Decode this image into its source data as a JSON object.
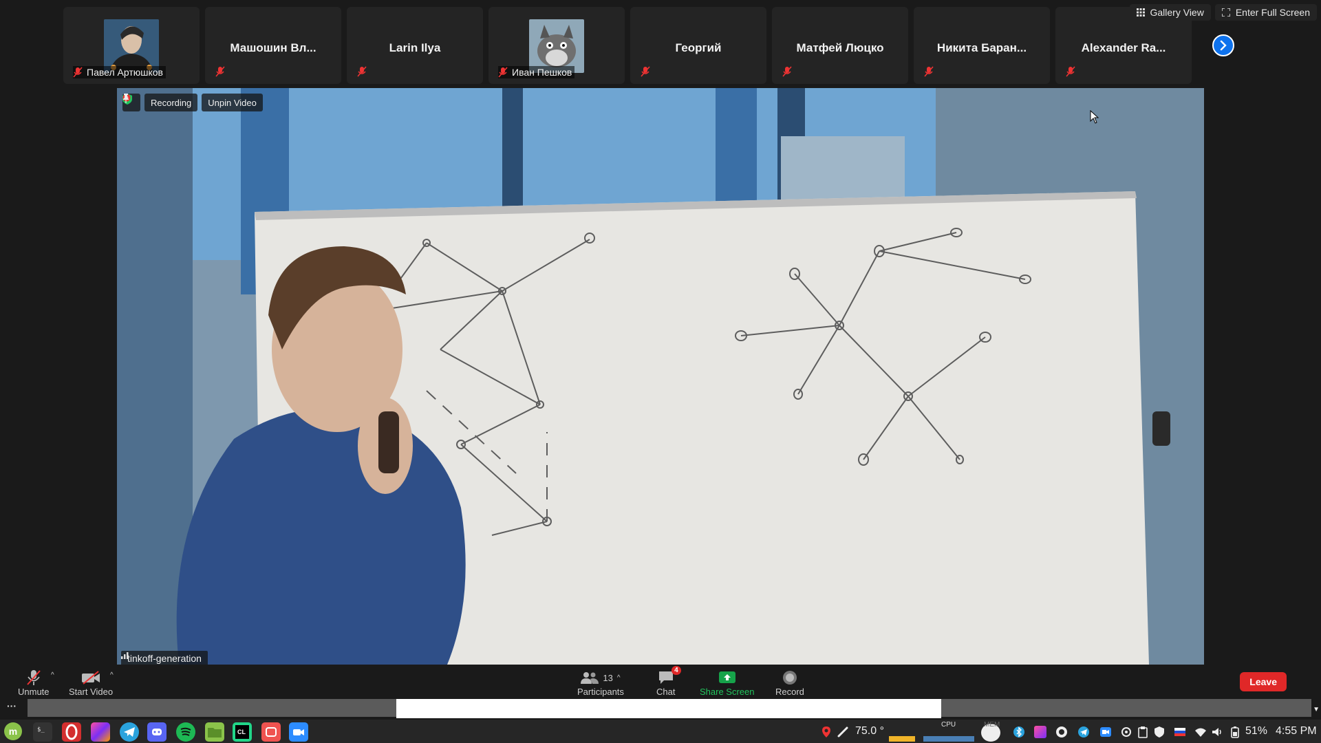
{
  "participants": [
    {
      "name": "Павел Артюшков",
      "kind": "photo"
    },
    {
      "name": "Машошин Вл...",
      "kind": "name"
    },
    {
      "name": "Larin Ilya",
      "kind": "name"
    },
    {
      "name": "Иван Пешков",
      "kind": "photo"
    },
    {
      "name": "Георгий",
      "kind": "name"
    },
    {
      "name": "Матфей Люцко",
      "kind": "name"
    },
    {
      "name": "Никита Баран...",
      "kind": "name"
    },
    {
      "name": "Alexander Ra...",
      "kind": "name"
    }
  ],
  "top_actions": {
    "gallery_view": "Gallery View",
    "full_screen": "Enter Full Screen"
  },
  "video": {
    "recording_label": "Recording",
    "unpin_label": "Unpin Video",
    "speaker_name": "tinkoff-generation"
  },
  "toolbar": {
    "unmute": "Unmute",
    "start_video": "Start Video",
    "participants_label": "Participants",
    "participants_count": "13",
    "chat_label": "Chat",
    "chat_badge": "4",
    "share_screen": "Share Screen",
    "record": "Record",
    "leave": "Leave"
  },
  "taskbar": {
    "temperature": "75.0 °",
    "cpu_label": "CPU",
    "mem_label": "MEM",
    "battery": "51%",
    "clock": "4:55 PM"
  },
  "colors": {
    "accent": "#0e72ed",
    "leave": "#e02828",
    "share": "#16a34a"
  }
}
